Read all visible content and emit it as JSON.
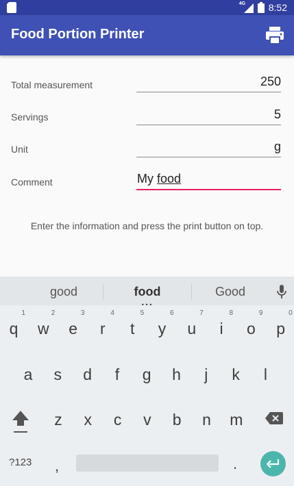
{
  "status_bar": {
    "time": "8:52",
    "network": "4G"
  },
  "app_bar": {
    "title": "Food Portion Printer",
    "action_icon": "print-icon"
  },
  "form": {
    "rows": [
      {
        "label": "Total measurement",
        "value": "250"
      },
      {
        "label": "Servings",
        "value": "5"
      },
      {
        "label": "Unit",
        "value": "g"
      },
      {
        "label": "Comment",
        "value_prefix": "My ",
        "value_word": "food"
      }
    ]
  },
  "hint": "Enter the information and press the print button on top.",
  "keyboard": {
    "suggestions": [
      "good",
      "food",
      "Good"
    ],
    "row1": [
      "q",
      "w",
      "e",
      "r",
      "t",
      "y",
      "u",
      "i",
      "o",
      "p"
    ],
    "row1_nums": [
      "1",
      "2",
      "3",
      "4",
      "5",
      "6",
      "7",
      "8",
      "9",
      "0"
    ],
    "row2": [
      "a",
      "s",
      "d",
      "f",
      "g",
      "h",
      "j",
      "k",
      "l"
    ],
    "row3": [
      "z",
      "x",
      "c",
      "v",
      "b",
      "n",
      "m"
    ],
    "symbols_label": "?123",
    "comma": ",",
    "period": ".",
    "accent_color": "#4db6ac"
  },
  "colors": {
    "primary": "#3f51b5",
    "primary_dark": "#303f9f",
    "accent": "#e91e63"
  }
}
